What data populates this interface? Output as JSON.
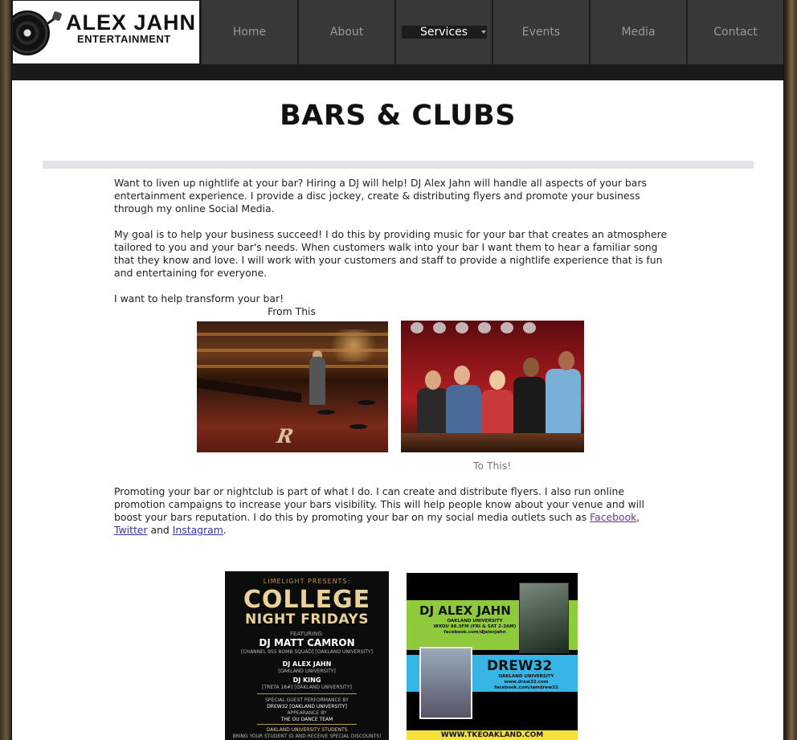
{
  "logo": {
    "title": "ALEX JAHN",
    "subtitle": "ENTERTAINMENT"
  },
  "nav": {
    "items": [
      {
        "label": "Home"
      },
      {
        "label": "About"
      },
      {
        "label": "Services"
      },
      {
        "label": "Events"
      },
      {
        "label": "Media"
      },
      {
        "label": "Contact"
      }
    ],
    "active": "Services"
  },
  "page": {
    "title": "BARS & CLUBS",
    "intro": "Want to liven up nightlife at your bar? Hiring a DJ will help! DJ Alex Jahn will handle all aspects of your bars entertainment experience. I provide a disc jockey, create & distributing flyers and promote your business through my online Social Media.",
    "goal": "My goal is to help your business succeed! I do this by providing music for your bar that creates an atmosphere tailored to you and your bar's needs. When customers walk into your bar I want them to hear a familiar song that they know and love. I will work with your customers and staff to provide a nightlife experience that is fun and entertaining for everyone.",
    "transform": "I want to help transform your bar!",
    "from_caption": "From This",
    "to_caption": "To This!",
    "promo_text": "Promoting your bar or nightclub is part of what I do. I can create and distribute flyers. I also run online promotion campaigns to increase your bars visibility. This will help people know about your venue and will boost your bars reputation. I do this by promoting your bar on my social media outlets such as",
    "link_facebook": "Facebook",
    "link_twitter": "Twitter",
    "link_and": "and",
    "link_instagram": "Instagram"
  },
  "flyer_college": {
    "presents": "LIMELIGHT PRESENTS:",
    "title1": "COLLEGE",
    "title2": "NIGHT FRIDAYS",
    "featuring": "FEATURING:",
    "dj1": "DJ MATT CAMRON",
    "dj1_sub": "[CHANNEL 955 BOMB SQUAD] [OAKLAND UNIVERSITY]",
    "dj2": "DJ ALEX JAHN",
    "dj2_sub": "[OAKLAND UNIVERSITY]",
    "dj3": "DJ KING",
    "dj3_sub": "[TRETA 18#] [OAKLAND UNIVERSITY]",
    "guest_note": "SPECIAL GUEST PERFORMANCE BY",
    "guest": "DREW32 [OAKLAND UNIVERSITY]",
    "appearance": "APPEARANCE BY",
    "team": "THE OU DANCE TEAM",
    "students": "OAKLAND UNIVERSITY STUDENTS",
    "students_sub": "BRING YOUR STUDENT ID AND RECEIVE SPECIAL DISCOUNTS!"
  },
  "flyer_dj": {
    "name1": "DJ ALEX JAHN",
    "line1": "OAKLAND UNIVERSITY",
    "line2": "WXOU 88.3FM (FRI & SAT 2-3AM)",
    "line3": "facebook.com/djalexjahn",
    "name2": "DREW32",
    "line4": "OAKLAND UNIVERSITY",
    "line5": "www.drew32.com",
    "line6": "facebook.com/iamdrew32",
    "url": "WWW.TKEOAKLAND.COM"
  },
  "colors": {
    "nav_bg": "#383838",
    "nav_active_bg": "#1c1c1c",
    "divider": "#e3e3e8",
    "link": "#3333aa",
    "link_visited": "#6a3a8a"
  }
}
